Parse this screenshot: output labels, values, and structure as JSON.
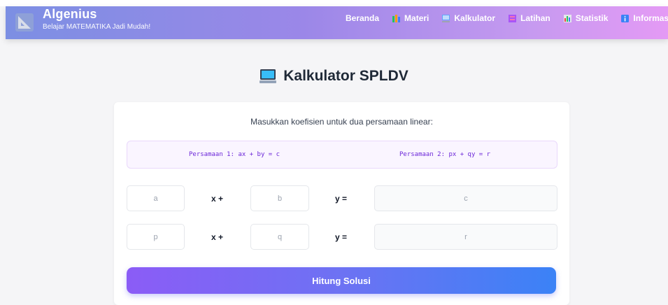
{
  "brand": {
    "name": "Algenius",
    "tagline": "Belajar MATEMATIKA Jadi Mudah!"
  },
  "nav": [
    {
      "label": "Beranda",
      "icon": ""
    },
    {
      "label": "Materi",
      "icon": "books-icon"
    },
    {
      "label": "Kalkulator",
      "icon": "computer-icon"
    },
    {
      "label": "Latihan",
      "icon": "notebook-icon"
    },
    {
      "label": "Statistik",
      "icon": "bar-chart-icon"
    },
    {
      "label": "Informasi",
      "icon": "info-icon"
    }
  ],
  "page": {
    "title": "Kalkulator SPLDV",
    "title_icon": "computer-icon"
  },
  "card": {
    "instruction": "Masukkan koefisien untuk dua persamaan linear:",
    "equation1": "Persamaan 1: ax + by = c",
    "equation2": "Persamaan 2: px + qy = r",
    "row1": {
      "a_placeholder": "a",
      "x_op": "x +",
      "b_placeholder": "b",
      "y_op": "y =",
      "c_placeholder": "c"
    },
    "row2": {
      "p_placeholder": "p",
      "x_op": "x +",
      "q_placeholder": "q",
      "y_op": "y =",
      "r_placeholder": "r"
    },
    "button": "Hitung Solusi"
  },
  "colors": {
    "accent_purple": "#8b5cf6",
    "accent_blue": "#3b82f6",
    "equation_text": "#6d28d9"
  }
}
